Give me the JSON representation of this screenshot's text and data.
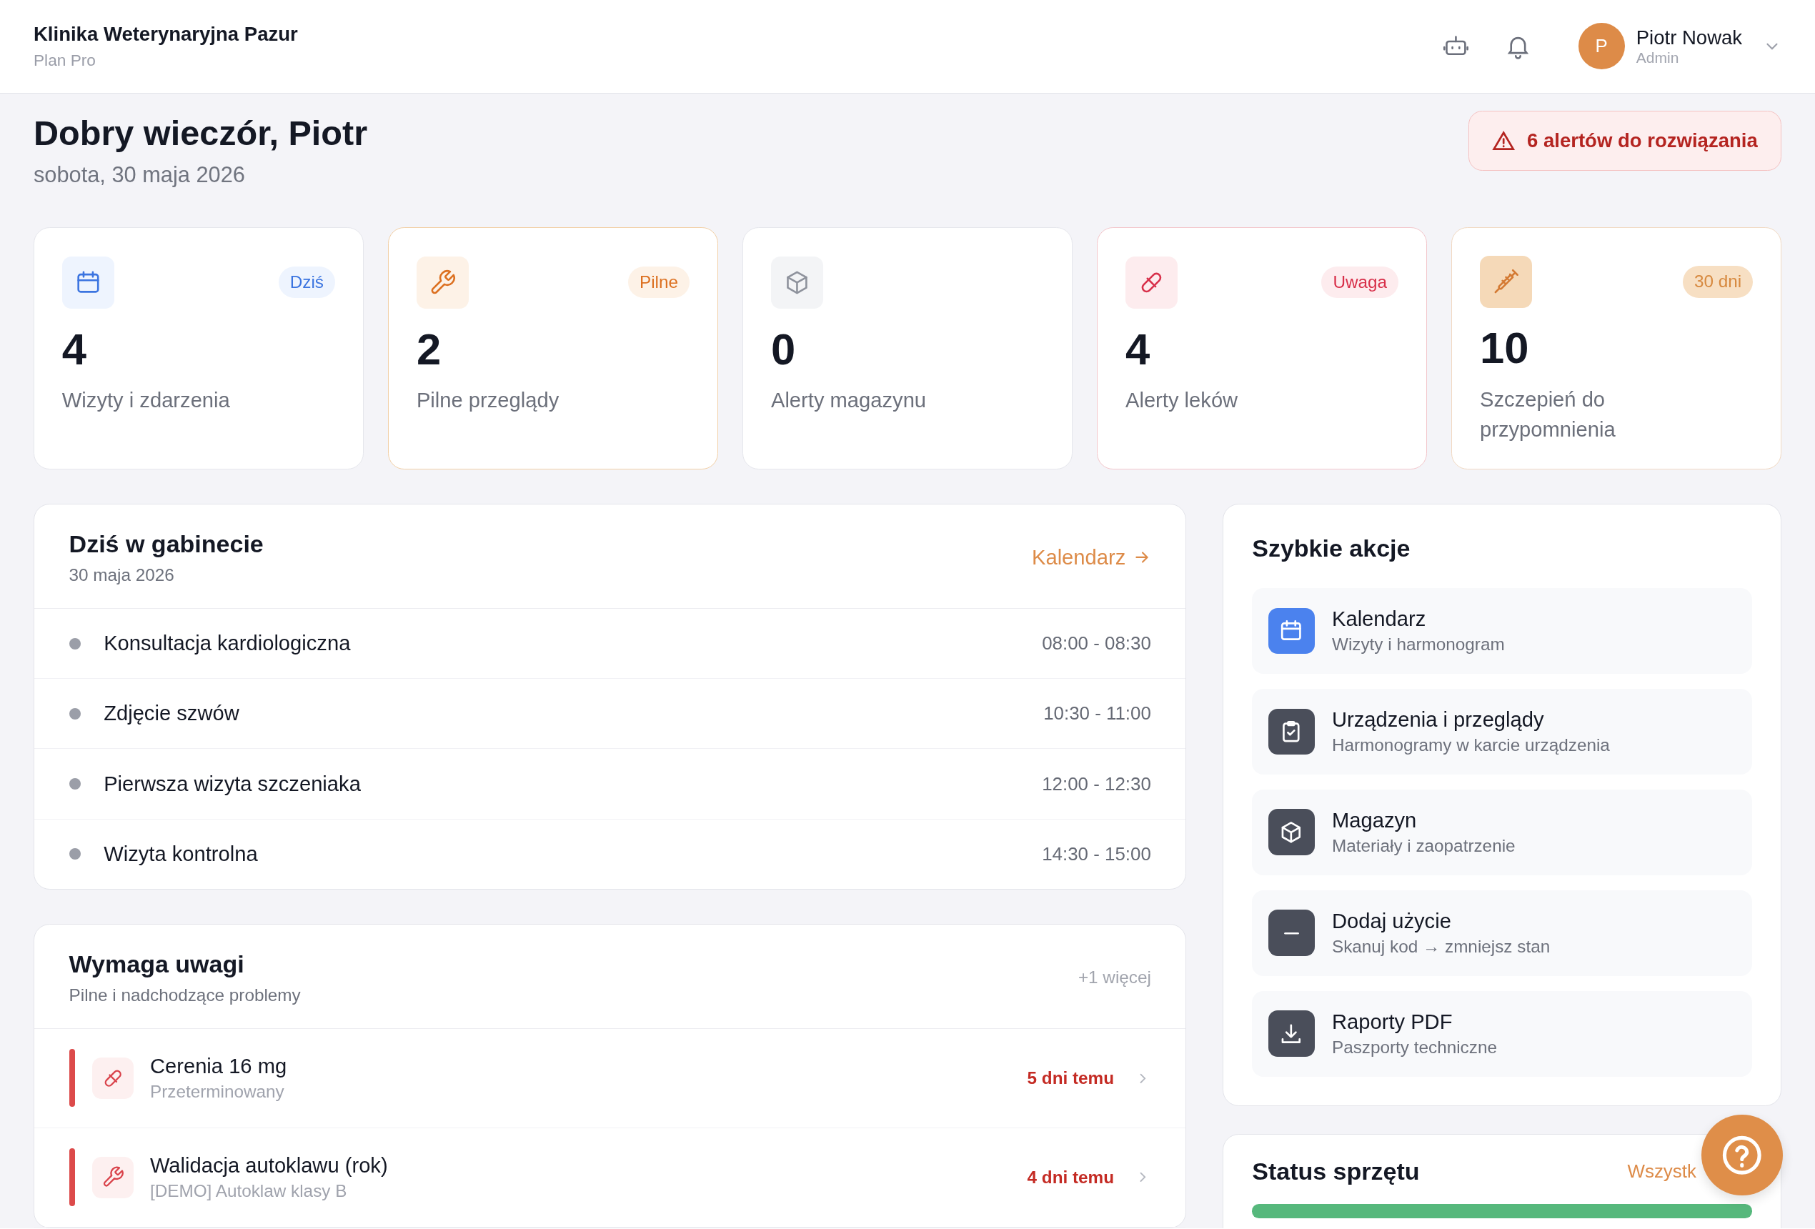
{
  "header": {
    "clinic_name": "Klinika Weterynaryjna Pazur",
    "plan": "Plan Pro",
    "user": {
      "initial": "P",
      "name": "Piotr Nowak",
      "role": "Admin"
    }
  },
  "greeting": {
    "title": "Dobry wieczór, Piotr",
    "date": "sobota, 30 maja 2026",
    "alert_button": "6 alertów do rozwiązania"
  },
  "stats": [
    {
      "value": "4",
      "label": "Wizyty i zdarzenia",
      "badge": "Dziś"
    },
    {
      "value": "2",
      "label": "Pilne przeglądy",
      "badge": "Pilne"
    },
    {
      "value": "0",
      "label": "Alerty magazynu"
    },
    {
      "value": "4",
      "label": "Alerty leków",
      "badge": "Uwaga"
    },
    {
      "value": "10",
      "label": "Szczepień do przypomnienia",
      "badge": "30 dni"
    }
  ],
  "today": {
    "title": "Dziś w gabinecie",
    "date": "30 maja 2026",
    "link": "Kalendarz",
    "events": [
      {
        "title": "Konsultacja kardiologiczna",
        "time": "08:00 - 08:30"
      },
      {
        "title": "Zdjęcie szwów",
        "time": "10:30 - 11:00"
      },
      {
        "title": "Pierwsza wizyta szczeniaka",
        "time": "12:00 - 12:30"
      },
      {
        "title": "Wizyta kontrolna",
        "time": "14:30 - 15:00"
      }
    ]
  },
  "attention": {
    "title": "Wymaga uwagi",
    "subtitle": "Pilne i nadchodzące problemy",
    "more": "+1 więcej",
    "items": [
      {
        "title": "Cerenia 16 mg",
        "subtitle": "Przeterminowany",
        "when": "5 dni temu"
      },
      {
        "title": "Walidacja autoklawu (rok)",
        "subtitle": "[DEMO] Autoklaw klasy B",
        "when": "4 dni temu"
      }
    ]
  },
  "quick_actions": {
    "title": "Szybkie akcje",
    "items": [
      {
        "title": "Kalendarz",
        "subtitle": "Wizyty i harmonogram"
      },
      {
        "title": "Urządzenia i przeglądy",
        "subtitle": "Harmonogramy w karcie urządzenia"
      },
      {
        "title": "Magazyn",
        "subtitle": "Materiały i zaopatrzenie"
      },
      {
        "title": "Dodaj użycie",
        "subtitle": "Skanuj kod → zmniejsz stan"
      },
      {
        "title": "Raporty PDF",
        "subtitle": "Paszporty techniczne"
      }
    ]
  },
  "equipment_status": {
    "title": "Status sprzętu",
    "link": "Wszystk"
  }
}
